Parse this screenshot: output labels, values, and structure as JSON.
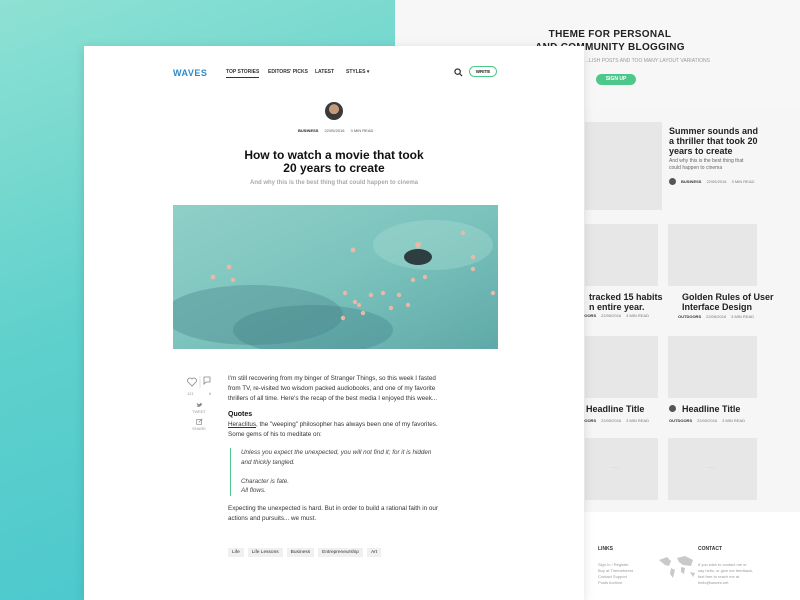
{
  "back": {
    "title_line1": "THEME FOR PERSONAL",
    "title_line2": "AND COMMUNITY BLOGGING",
    "subtitle": "...LISH POSTS AND TOO MANY LAYOUT VARIATIONS",
    "signup": "SIGN UP",
    "featured": {
      "title_line1": "Summer sounds and",
      "title_line2": "a thriller that took 20",
      "title_line3": "years to create",
      "excerpt_line1": "And why this is the best thing that",
      "excerpt_line2": "could happen to cinema",
      "category": "BUSINESS",
      "date": "22/05/2016",
      "read": "3 MIN READ"
    },
    "cards": [
      {
        "title": "tracked 15 habits",
        "title2": "n entire year.",
        "category": "OUTDOORS",
        "date": "22/05/2016",
        "read": "3 MIN READ"
      },
      {
        "title": "Golden Rules of User",
        "title2": "Interface Design",
        "category": "OUTDOORS",
        "date": "22/05/2016",
        "read": "3 MIN READ"
      },
      {
        "title": "Headline Title",
        "category": "OUTDOORS",
        "date": "22/05/2016",
        "read": "3 MIN READ"
      },
      {
        "title": "Headline Title",
        "category": "OUTDOORS",
        "date": "22/05/2016",
        "read": "3 MIN READ"
      }
    ],
    "dots": "...",
    "footer": {
      "links_head": "LINKS",
      "links": [
        "Sign In / Register",
        "Buy at Themeforest",
        "Contact Support",
        "Posts Archive"
      ],
      "contact_head": "CONTACT",
      "contact_lines": [
        "If you wish to contact me or",
        "say hello, or give me feedback,",
        "feel free to reach me at",
        "hello@waves.net"
      ]
    }
  },
  "header": {
    "logo": "WAVES",
    "nav": [
      "TOP STORIES",
      "EDITORS' PICKS",
      "LATEST",
      "STYLES ▾"
    ],
    "write": "WRITE"
  },
  "article": {
    "category": "BUSINESS",
    "date": "22/05/2016",
    "read_time": "3 MIN READ",
    "title_line1": "How to watch a movie that took",
    "title_line2": "20 years to create",
    "subtitle": "And why this is the best thing that could happen to cinema",
    "likes": "121",
    "comments": "8",
    "tweet": "TWEET",
    "share": "SHARE",
    "intro": "I'm still recovering from my binger of Stranger Things, so this week I fasted from TV, re-visited two wisdom packed audiobooks, and one of my favorite thrillers of all time. Here's the recap of the best media I enjoyed this week...",
    "quotes_heading": "Quotes",
    "quotes_link": "Heraclitus",
    "quotes_text": ", the \"weeping\" philosopher has always been one of my favorites. Some gems of his to meditate on:",
    "quote1_line1": "Unless you expect the unexpected, you will not find it; for it is hidden",
    "quote1_line2": "and thickly tangled.",
    "quote2_line1": "Character is fate.",
    "quote2_line2": "All flows.",
    "outro": "Expecting the unexpected is hard. But in order to build a rational faith in our actions and pursuits... we must.",
    "tags": [
      "Life",
      "Life Lessons",
      "Business",
      "Entrepreneurship",
      "Art"
    ]
  },
  "colors": {
    "accent": "#4cc98a",
    "logo": "#2e8bc8",
    "sea": "#7fc4bd"
  }
}
